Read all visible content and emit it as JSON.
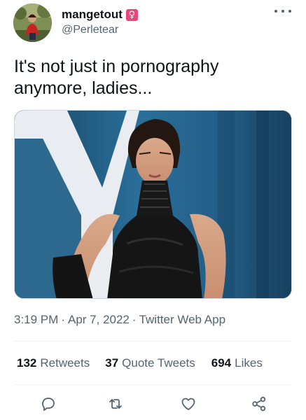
{
  "author": {
    "display_name": "mangetout",
    "gender_badge": "♀",
    "handle": "@Perletear",
    "badge_color": "#e8457a"
  },
  "header": {
    "more_icon": "more-horizontal-icon"
  },
  "tweet": {
    "text": "It's not just in pornography\nanymore, ladies..."
  },
  "meta": {
    "time": "3:19 PM",
    "separator": "·",
    "date": "Apr 7, 2022",
    "source": "Twitter Web App"
  },
  "stats": {
    "retweets_count": "132",
    "retweets_label": "Retweets",
    "quotes_count": "37",
    "quotes_label": "Quote Tweets",
    "likes_count": "694",
    "likes_label": "Likes"
  },
  "actions": {
    "reply_icon": "reply-icon",
    "retweet_icon": "retweet-icon",
    "like_icon": "heart-icon",
    "share_icon": "share-icon"
  },
  "colors": {
    "text_primary": "#0f1419",
    "text_secondary": "#536471",
    "divider": "#eff3f4"
  }
}
